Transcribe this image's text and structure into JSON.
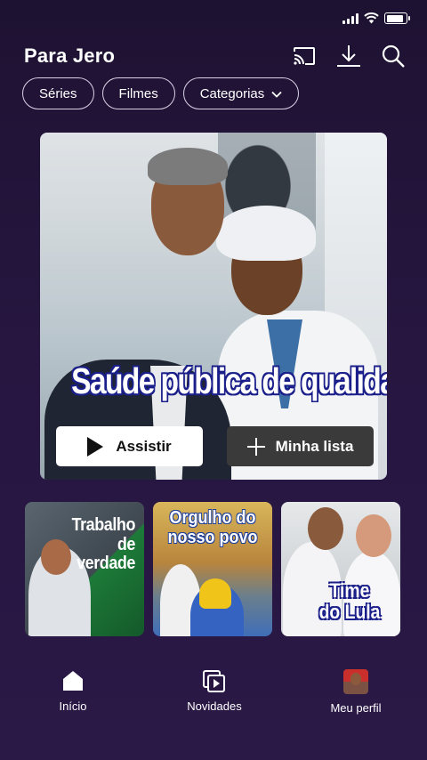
{
  "status_bar": {
    "battery_level": 0.9
  },
  "header": {
    "title": "Para Jero",
    "icons": [
      "cast-icon",
      "download-icon",
      "search-icon"
    ]
  },
  "chips": [
    {
      "label": "Séries"
    },
    {
      "label": "Filmes"
    },
    {
      "label": "Categorias",
      "icon": "chevron-down-icon"
    }
  ],
  "hero": {
    "caption": "Saúde pública de qualidade",
    "play_label": "Assistir",
    "list_label": "Minha lista"
  },
  "thumbnails": [
    {
      "title": "Trabalho de\nverdade"
    },
    {
      "title": "Orgulho do\nnosso povo"
    },
    {
      "title": "Time\ndo Lula"
    }
  ],
  "bottom_nav": [
    {
      "label": "Início",
      "icon": "home-icon"
    },
    {
      "label": "Novidades",
      "icon": "play-stack-icon"
    },
    {
      "label": "Meu perfil",
      "icon": "avatar"
    }
  ],
  "colors": {
    "background": "#261640",
    "caption_outline": "#1b1f8a"
  }
}
